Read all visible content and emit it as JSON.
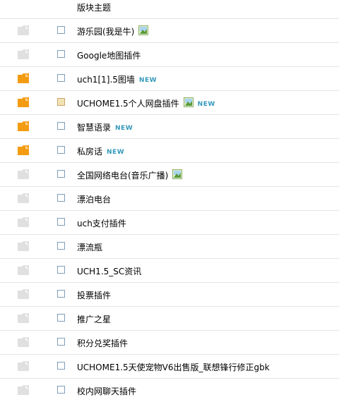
{
  "header": {
    "label": "版块主题"
  },
  "colors": {
    "new_badge": "#3399bb",
    "folder_new": "#f39c12",
    "folder_read": "#e0e0e0"
  },
  "rows": [
    {
      "title": "游乐园(我是牛)",
      "folder": "read",
      "has_image": true,
      "is_new": false,
      "highlight": false
    },
    {
      "title": "Google地图插件",
      "folder": "read",
      "has_image": false,
      "is_new": false,
      "highlight": false
    },
    {
      "title": "uch1[1].5图墙",
      "folder": "new",
      "has_image": false,
      "is_new": true,
      "highlight": false
    },
    {
      "title": "UCHOME1.5个人网盘插件",
      "folder": "new",
      "has_image": true,
      "is_new": true,
      "highlight": true
    },
    {
      "title": "智慧语录",
      "folder": "new",
      "has_image": false,
      "is_new": true,
      "highlight": false
    },
    {
      "title": "私房话",
      "folder": "new",
      "has_image": false,
      "is_new": true,
      "highlight": false
    },
    {
      "title": "全国网络电台(音乐广播)",
      "folder": "read",
      "has_image": true,
      "is_new": false,
      "highlight": false
    },
    {
      "title": "漂泊电台",
      "folder": "read",
      "has_image": false,
      "is_new": false,
      "highlight": false
    },
    {
      "title": "uch支付插件",
      "folder": "read",
      "has_image": false,
      "is_new": false,
      "highlight": false
    },
    {
      "title": "漂流瓶",
      "folder": "read",
      "has_image": false,
      "is_new": false,
      "highlight": false
    },
    {
      "title": "UCH1.5_SC资讯",
      "folder": "read",
      "has_image": false,
      "is_new": false,
      "highlight": false
    },
    {
      "title": "投票插件",
      "folder": "read",
      "has_image": false,
      "is_new": false,
      "highlight": false
    },
    {
      "title": "推广之星",
      "folder": "read",
      "has_image": false,
      "is_new": false,
      "highlight": false
    },
    {
      "title": "积分兑奖插件",
      "folder": "read",
      "has_image": false,
      "is_new": false,
      "highlight": false
    },
    {
      "title": "UCHOME1.5天使宠物V6出售版_联想锋行修正gbk",
      "folder": "read",
      "has_image": false,
      "is_new": false,
      "highlight": false
    },
    {
      "title": "校内网聊天插件",
      "folder": "read",
      "has_image": false,
      "is_new": false,
      "highlight": false
    }
  ],
  "new_badge_text": "NEW"
}
